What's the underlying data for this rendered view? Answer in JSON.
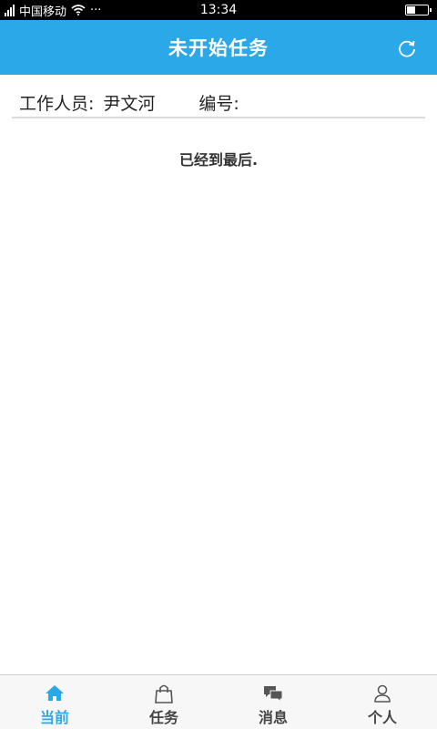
{
  "status_bar": {
    "carrier": "中国移动",
    "dots": "···",
    "time": "13:34"
  },
  "header": {
    "title": "未开始任务",
    "refresh_icon": "refresh-icon"
  },
  "worker": {
    "label": "工作人员:",
    "name": "尹文河",
    "number_label": "编号:",
    "number": ""
  },
  "list": {
    "end_message": "已经到最后."
  },
  "tabs": [
    {
      "label": "当前",
      "icon": "home-icon",
      "active": true
    },
    {
      "label": "任务",
      "icon": "bag-icon",
      "active": false
    },
    {
      "label": "消息",
      "icon": "chat-icon",
      "active": false
    },
    {
      "label": "个人",
      "icon": "person-icon",
      "active": false
    }
  ],
  "colors": {
    "accent": "#2aa8e8",
    "status_bar": "#000000",
    "tab_bar": "#f7f7f7"
  }
}
